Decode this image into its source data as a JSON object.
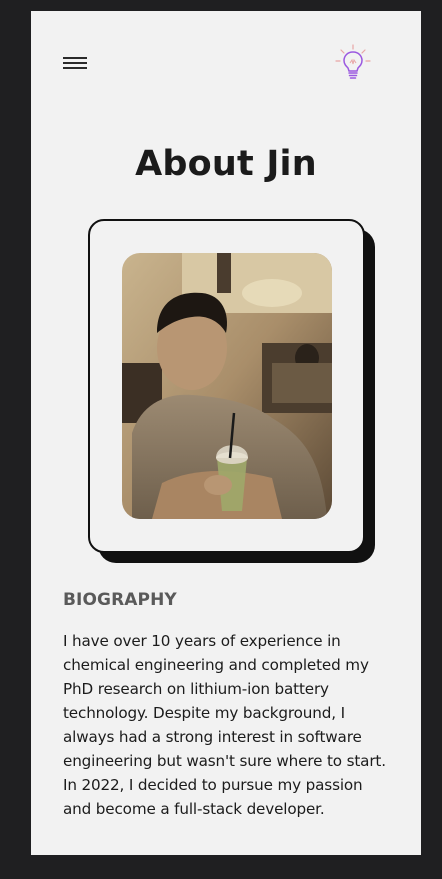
{
  "header": {
    "menu_icon": "hamburger-menu-icon",
    "theme_icon": "lightbulb-icon"
  },
  "page_title": "About Jin",
  "profile_photo": {
    "alt": "Jin"
  },
  "biography": {
    "heading": "BIOGRAPHY",
    "text": "I have over 10 years of experience in chemical engineering and completed my PhD research on lithium-ion battery technology. Despite my background, I always had a strong interest in software engineering but wasn't sure where to start. In 2022, I decided to pursue my passion and become a full-stack developer."
  },
  "colors": {
    "page_background": "#f2f2f2",
    "outer_background": "#1f1f21",
    "accent_bulb": "#9b59e0",
    "card_shadow": "#111111"
  }
}
